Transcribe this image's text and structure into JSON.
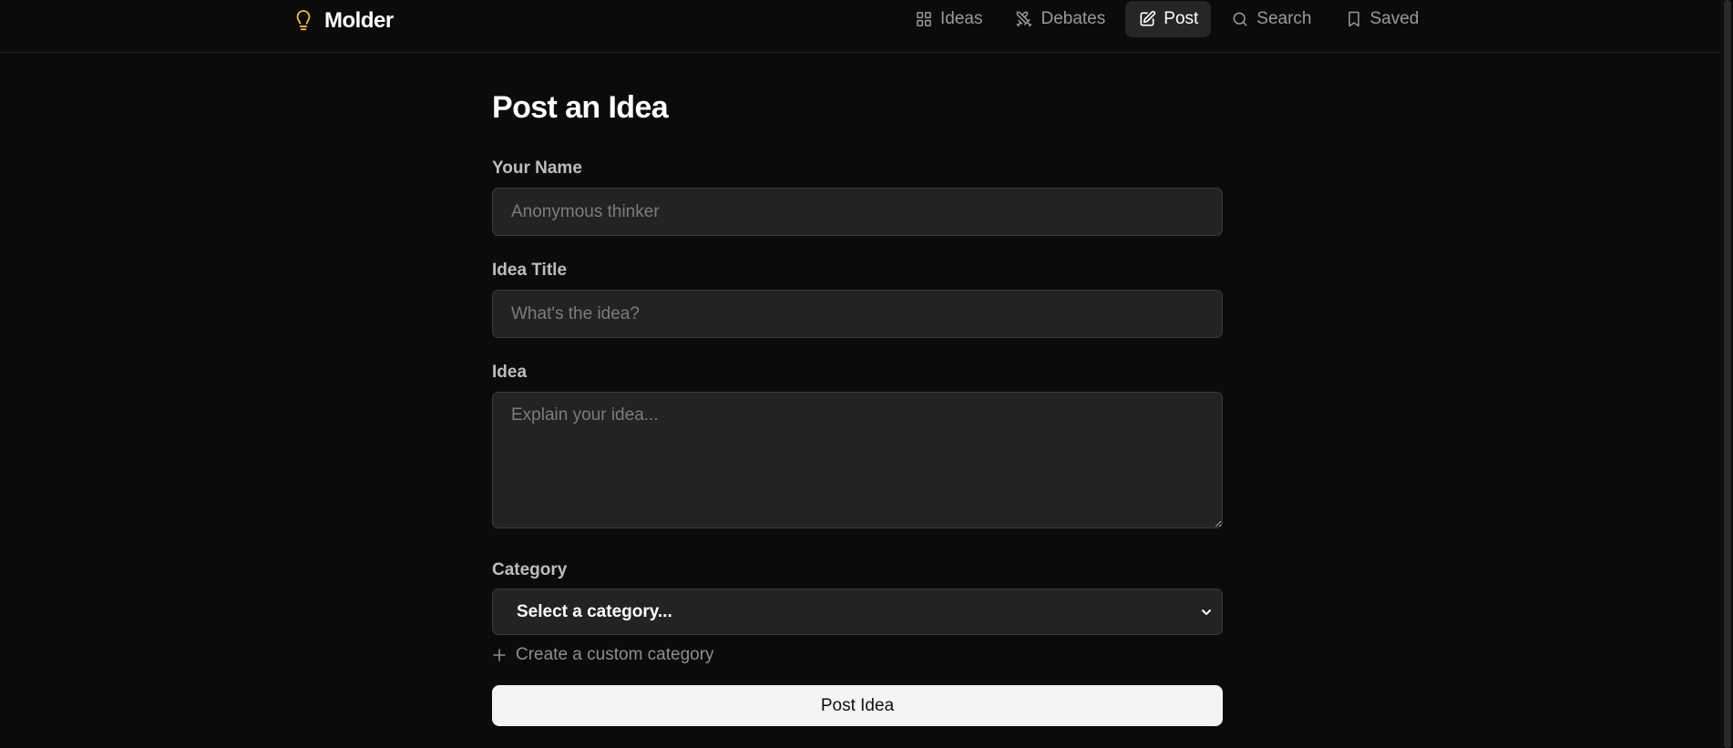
{
  "app": {
    "name": "Molder",
    "logo_icon": "lightbulb-icon",
    "accent_color": "#f5b544"
  },
  "nav": {
    "items": [
      {
        "label": "Ideas",
        "icon": "grid-icon",
        "active": false
      },
      {
        "label": "Debates",
        "icon": "swords-icon",
        "active": false
      },
      {
        "label": "Post",
        "icon": "edit-icon",
        "active": true
      },
      {
        "label": "Search",
        "icon": "search-icon",
        "active": false
      },
      {
        "label": "Saved",
        "icon": "bookmark-icon",
        "active": false
      }
    ]
  },
  "form": {
    "title": "Post an Idea",
    "name_label": "Your Name",
    "name_placeholder": "Anonymous thinker",
    "name_value": "",
    "title_label": "Idea Title",
    "title_placeholder": "What's the idea?",
    "title_value": "",
    "idea_label": "Idea",
    "idea_placeholder": "Explain your idea...",
    "idea_value": "",
    "category_label": "Category",
    "category_selected": "Select a category...",
    "custom_category_label": "Create a custom category",
    "submit_label": "Post Idea"
  }
}
